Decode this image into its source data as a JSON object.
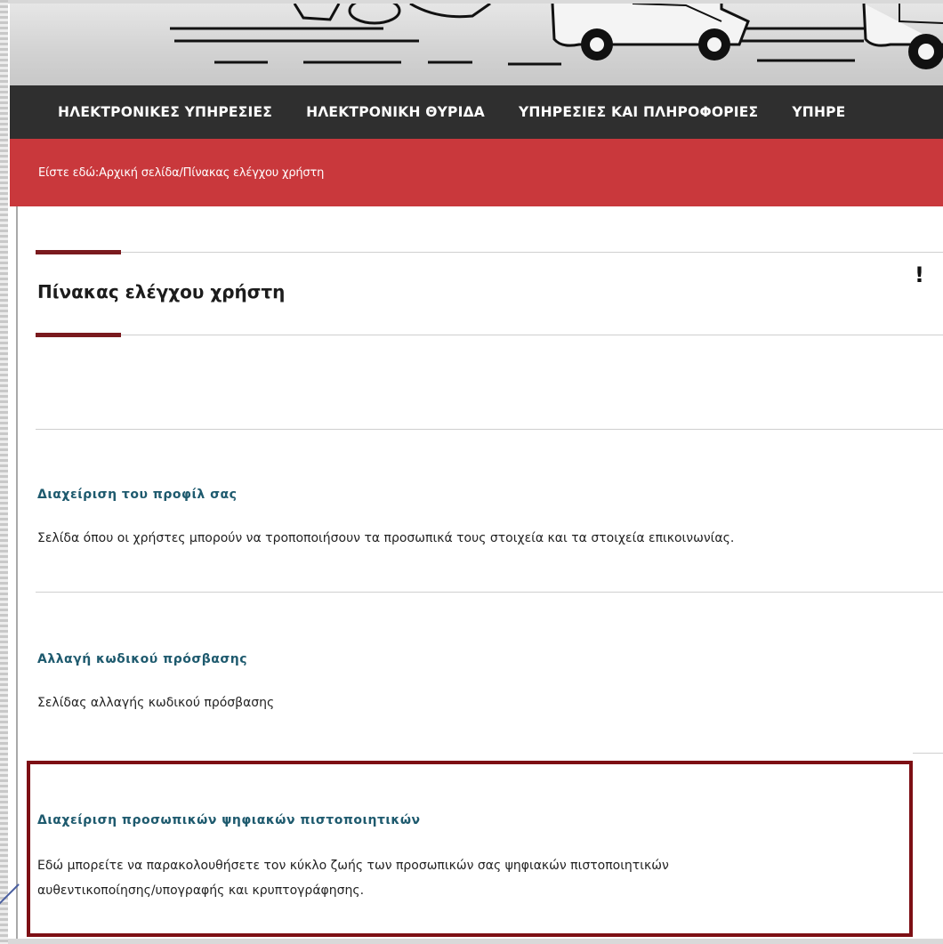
{
  "nav": {
    "items": [
      "ΗΛΕΚΤΡΟΝΙΚΕΣ ΥΠΗΡΕΣΙΕΣ",
      "ΗΛΕΚΤΡΟΝΙΚΗ ΘΥΡΙΔΑ",
      "ΥΠΗΡΕΣΙΕΣ ΚΑΙ ΠΛΗΡΟΦΟΡΙΕΣ",
      "ΥΠΗΡΕ"
    ]
  },
  "breadcrumb": {
    "prefix": "Είστε εδώ: ",
    "home": "Αρχική σελίδα",
    "separator": " / ",
    "current": "Πίνακας ελέγχου χρήστη"
  },
  "page": {
    "title": "Πίνακας ελέγχου χρήστη",
    "alert_glyph": "!"
  },
  "sections": [
    {
      "title": "Διαχείριση του προφίλ σας",
      "description": "Σελίδα όπου οι χρήστες μπορούν να τροποποιήσουν τα προσωπικά τους στοιχεία και τα στοιχεία επικοινωνίας."
    },
    {
      "title": "Αλλαγή κωδικού πρόσβασης",
      "description": "Σελίδας αλλαγής κωδικού πρόσβασης"
    },
    {
      "title": "Διαχείριση προσωπικών ψηφιακών πιστοποιητικών",
      "description_line1": "Εδώ μπορείτε να παρακολουθήσετε τον κύκλο ζωής των προσωπικών σας ψηφιακών πιστοποιητικών",
      "description_line2": "αυθεντικοποίησης/υπογραφής και κρυπτογράφησης."
    }
  ],
  "colors": {
    "nav_bg": "#2f2f2f",
    "breadcrumb_bg": "#c9383c",
    "accent": "#7a1a1e",
    "link": "#1e5a6e",
    "highlight_border": "#7d0f14"
  }
}
